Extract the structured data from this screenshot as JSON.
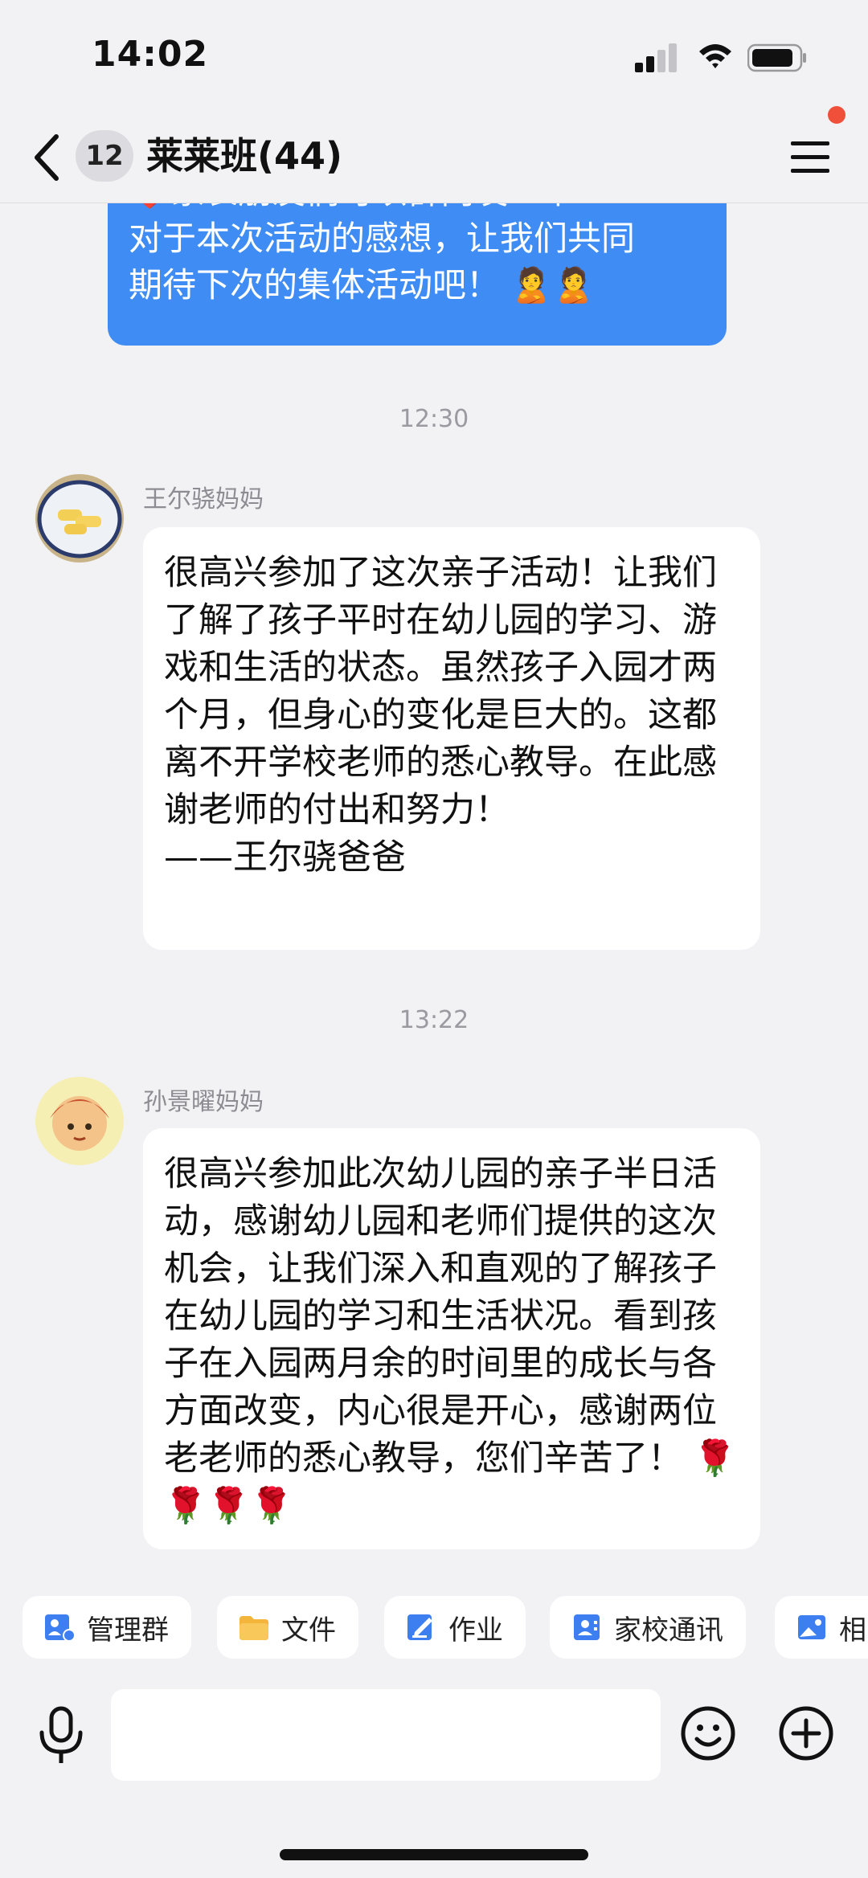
{
  "status_bar": {
    "time": "14:02"
  },
  "header": {
    "unread_count": "12",
    "title": "莱莱班(44)"
  },
  "messages": {
    "self_bubble_lines": [
      "❤️家长朋友们可以群内发一下",
      "对于本次活动的感想，让我们共同",
      "期待下次的集体活动吧！ 🙎🙎"
    ],
    "time1": "12:30",
    "sender1": "王尔骁妈妈",
    "text1": "很高兴参加了这次亲子活动！让我们了解了孩子平时在幼儿园的学习、游戏和生活的状态。虽然孩子入园才两个月，但身心的变化是巨大的。这都离不开学校老师的悉心教导。在此感谢老师的付出和努力！\n——王尔骁爸爸",
    "time2": "13:22",
    "sender2": "孙景曜妈妈",
    "text2": "很高兴参加此次幼儿园的亲子半日活动，感谢幼儿园和老师们提供的这次机会，让我们深入和直观的了解孩子在幼儿园的学习和生活状况。看到孩子在入园两月余的时间里的成长与各方面改变，内心很是开心，感谢两位老老师的悉心教导，您们辛苦了！ 🌹🌹🌹🌹"
  },
  "shortcuts": [
    {
      "label": "管理群",
      "icon": "group-manage-icon"
    },
    {
      "label": "文件",
      "icon": "folder-icon"
    },
    {
      "label": "作业",
      "icon": "homework-icon"
    },
    {
      "label": "家校通讯",
      "icon": "contacts-icon"
    },
    {
      "label": "相",
      "icon": "album-icon"
    }
  ],
  "input": {
    "placeholder": ""
  },
  "colors": {
    "accent": "#3e8cf4",
    "background": "#f2f2f5",
    "badge": "#f0503a"
  }
}
